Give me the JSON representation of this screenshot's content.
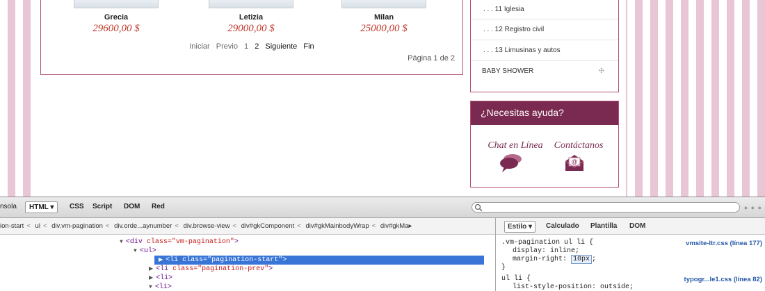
{
  "products": [
    {
      "name": "Grecia",
      "price": "29600,00 $"
    },
    {
      "name": "Letizia",
      "price": "29000,00 $"
    },
    {
      "name": "Milan",
      "price": "25000,00 $"
    }
  ],
  "pagination": {
    "start": "Iniciar",
    "prev": "Previo",
    "page1": "1",
    "page2": "2",
    "next": "Siguiente",
    "end": "Fin",
    "page_of": "Página 1 de 2"
  },
  "categories": [
    {
      "label": ". . . 11 Iglesia"
    },
    {
      "label": ". . . 12 Registro civil"
    },
    {
      "label": ". . . 13 Limusinas y autos"
    }
  ],
  "category_main": {
    "label": "BABY SHOWER",
    "icon": "plus-icon"
  },
  "help": {
    "title": "¿Necesitas ayuda?",
    "chat": "Chat en Línea",
    "contact": "Contáctanos"
  },
  "devtools": {
    "tabs": [
      "nsola",
      "HTML ▾",
      "CSS",
      "Script",
      "DOM",
      "Red"
    ],
    "breadcrumb": [
      "ion-start",
      "ul",
      "div.vm-pagination",
      "div.orde...aynumber",
      "div.browse-view",
      "div#gkComponent",
      "div#gkMainbodyWrap",
      "div#gkMa▸"
    ],
    "tree": [
      {
        "tag": "<div ",
        "attr": "class=\"vm-pagination\"",
        "end": ">"
      },
      {
        "tag": "<ul>",
        "attr": "",
        "end": ""
      },
      {
        "tag": "<li ",
        "attr": "class=\"pagination-start\"",
        "end": ">"
      },
      {
        "tag": "<li ",
        "attr": "class=\"pagination-prev\"",
        "end": ">"
      },
      {
        "tag": "<li>",
        "attr": "",
        "end": ""
      },
      {
        "tag": "<li>",
        "attr": "",
        "end": ""
      }
    ],
    "style_tabs": [
      "Estilo ▾",
      "Calculado",
      "Plantilla",
      "DOM"
    ],
    "rule1": {
      "selector": ".vm-pagination ul li {",
      "prop1": "display: inline;",
      "prop2_name": "margin-right: ",
      "prop2_value": "10px",
      "semicolon": ";",
      "close": "}",
      "source": "vmsite-ltr.css (línea 177)"
    },
    "rule2": {
      "selector": "ul li {",
      "prop1": "list-style-position: outside;",
      "source": "typogr...le1.css (línea 82)"
    }
  }
}
